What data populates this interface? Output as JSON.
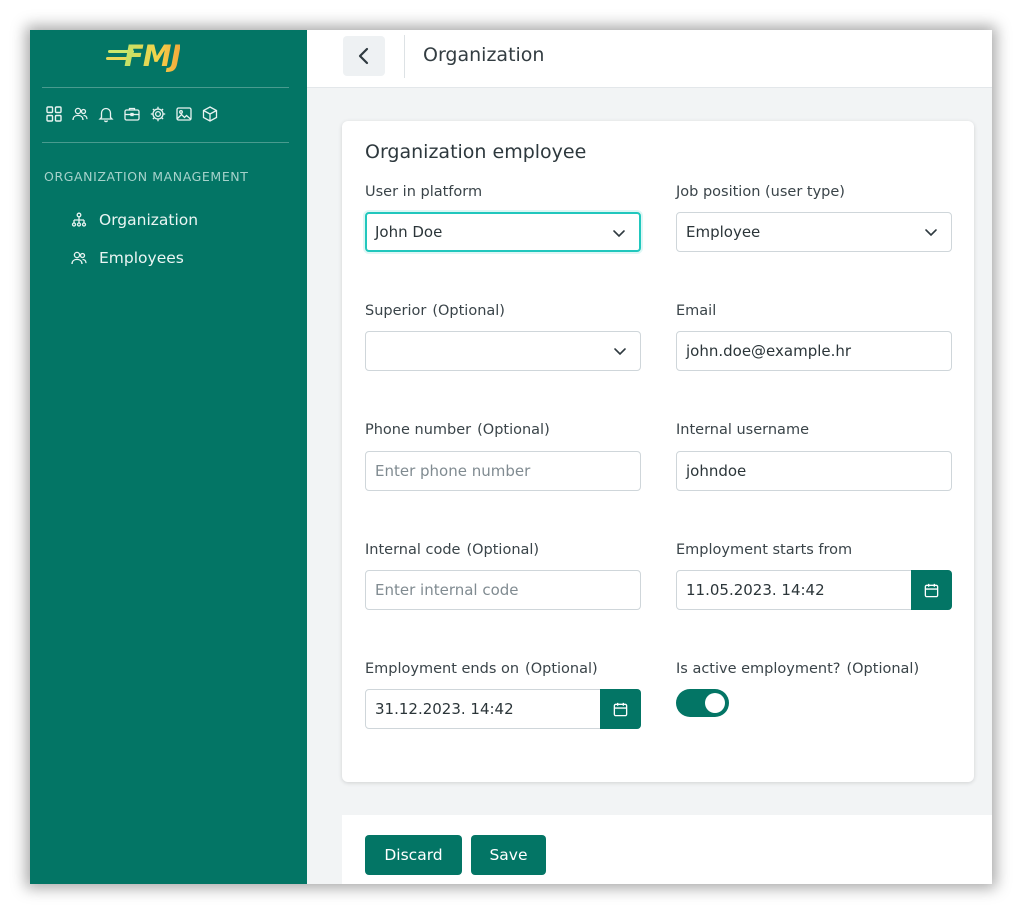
{
  "app": {
    "logo_text": "FMJ",
    "brand_color": "#037565",
    "accent_focus_color": "#21c7bd"
  },
  "sidebar": {
    "top_icons": [
      "dashboard-icon",
      "users-icon",
      "bell-icon",
      "briefcase-icon",
      "gear-icon",
      "image-icon",
      "cube-icon"
    ],
    "section_title": "ORGANIZATION MANAGEMENT",
    "items": [
      {
        "label": "Organization",
        "icon": "org-chart-icon"
      },
      {
        "label": "Employees",
        "icon": "users-icon"
      }
    ]
  },
  "header": {
    "back_icon": "chevron-left-icon",
    "title": "Organization"
  },
  "form": {
    "title": "Organization employee",
    "optional_suffix": "(Optional)",
    "user_in_platform": {
      "label": "User in platform",
      "value": "John Doe"
    },
    "job_position": {
      "label": "Job position (user type)",
      "value": "Employee"
    },
    "superior": {
      "label": "Superior",
      "value": ""
    },
    "email": {
      "label": "Email",
      "value": "john.doe@example.hr"
    },
    "phone": {
      "label": "Phone number",
      "placeholder": "Enter phone number"
    },
    "internal_username": {
      "label": "Internal username",
      "value": "johndoe"
    },
    "internal_code": {
      "label": "Internal code",
      "placeholder": "Enter internal code"
    },
    "employment_start": {
      "label": "Employment starts from",
      "value": "11.05.2023. 14:42"
    },
    "employment_end": {
      "label": "Employment ends on",
      "value": "31.12.2023. 14:42"
    },
    "is_active": {
      "label": "Is active employment?",
      "checked": true
    }
  },
  "footer": {
    "discard_label": "Discard",
    "save_label": "Save"
  }
}
